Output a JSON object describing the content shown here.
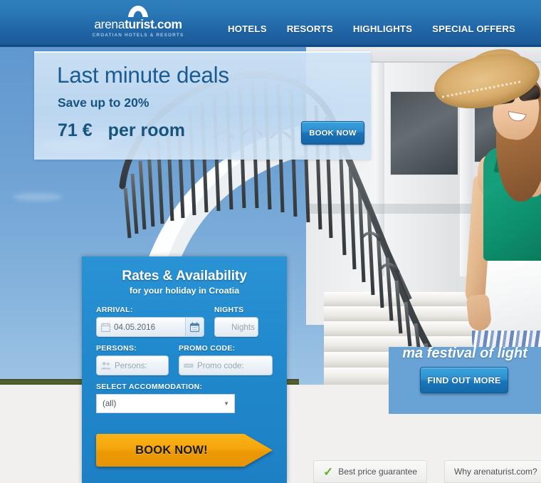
{
  "header": {
    "logo": {
      "mark": "mountain-arch-icon",
      "word_light": "arena",
      "word_bold": "turist.com",
      "tagline": "CROATIAN HOTELS & RESORTS"
    },
    "nav": [
      {
        "label": "HOTELS"
      },
      {
        "label": "RESORTS"
      },
      {
        "label": "HIGHLIGHTS"
      },
      {
        "label": "SPECIAL OFFERS"
      }
    ]
  },
  "promo": {
    "title": "Last minute deals",
    "subtitle": "Save up to 20%",
    "price": "71 €",
    "unit": "per room",
    "button": "BOOK NOW"
  },
  "booking": {
    "title": "Rates & Availability",
    "subtitle": "for your holiday in Croatia",
    "arrival": {
      "label": "ARRIVAL:",
      "value": "04.05.2016",
      "icon": "calendar-icon",
      "picker_icon": "calendar-picker-icon"
    },
    "nights": {
      "label": "NIGHTS",
      "placeholder": "Nights",
      "icon": "moon-icon"
    },
    "persons": {
      "label": "PERSONS:",
      "placeholder": "Persons:",
      "icon": "people-icon"
    },
    "promo_code": {
      "label": "PROMO CODE:",
      "placeholder": "Promo code:",
      "icon": "ticket-icon"
    },
    "accommodation": {
      "label": "SELECT ACCOMMODATION:",
      "value": "(all)",
      "arrow": "▼"
    },
    "submit": "BOOK NOW!"
  },
  "right_panel": {
    "caption": "ma festival of light",
    "button": "FIND OUT MORE"
  },
  "badges": [
    {
      "icon": "green-check-icon",
      "label": "Best price guarantee"
    },
    {
      "icon": "none",
      "label": "Why arenaturist.com?"
    }
  ],
  "colors": {
    "header_blue": "#2b78b7",
    "form_blue": "#2189cd",
    "accent_orange": "#f5a60c",
    "promo_panel": "#cfe2f5",
    "check_green": "#63b02e",
    "page_bg": "#f1f0ee"
  }
}
